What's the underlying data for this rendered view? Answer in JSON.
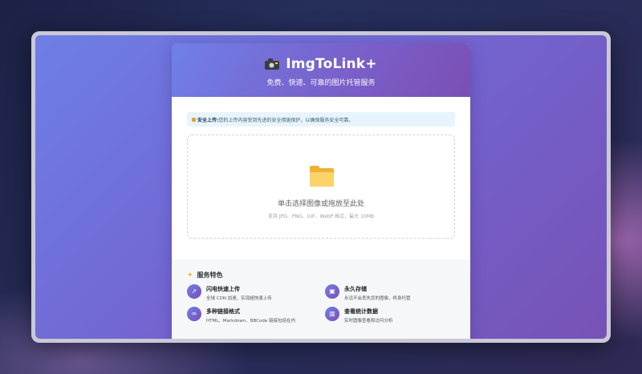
{
  "app": {
    "title": "ImgToLink+",
    "subtitle": "免费、快速、可靠的图片托管服务"
  },
  "notice": {
    "label": "安全上传:",
    "text": "您的上传内容受到先进的安全措施保护，以确保服务安全可靠。"
  },
  "upload": {
    "main_text": "单击选择图像或拖放至此处",
    "sub_text": "支持 JPG、PNG、GIF、WebP 格式，最大 10MB"
  },
  "features": {
    "title": "服务特色",
    "items": [
      {
        "icon": "rocket-icon",
        "glyph": "➚",
        "title": "闪电快速上传",
        "desc": "全球 CDN 加速，实现超快速上传"
      },
      {
        "icon": "floppy-disk-icon",
        "glyph": "▣",
        "title": "永久存储",
        "desc": "永远不会丢失您的图像，终身托管"
      },
      {
        "icon": "link-icon",
        "glyph": "∞",
        "title": "多种链接格式",
        "desc": "HTML、Markdown、BBCode 链接包括在内"
      },
      {
        "icon": "bar-chart-icon",
        "glyph": "▥",
        "title": "查看统计数据",
        "desc": "实时图像查看和访问分析"
      }
    ]
  },
  "colors": {
    "accent_start": "#6f80e8",
    "accent_end": "#7a4fb5",
    "notice_bg": "#e8f4fb",
    "folder": "#f0b132"
  }
}
